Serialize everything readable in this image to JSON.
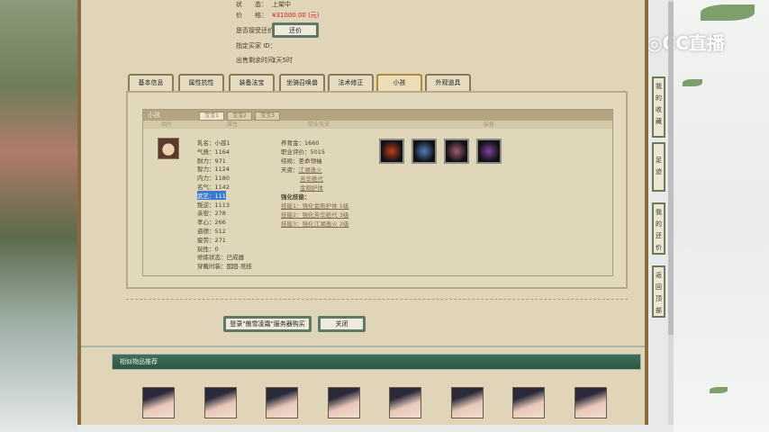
{
  "top_info": {
    "status_label": "状　　态：",
    "status_value": "上架中",
    "price_label": "价　　格：",
    "price_value": "¥31000.00 (元)",
    "counter_label": "是否接受还价：",
    "counter_button": "还价",
    "buyer_label": "指定买家 ID：",
    "time_label": "出售剩余时间：",
    "time_value": "1天5时"
  },
  "tabs": [
    "基本信息",
    "属性抗性",
    "装备法宝",
    "坐骑召唤兽",
    "法术修正",
    "小孩",
    "外观道具"
  ],
  "child": {
    "title": "小孩",
    "subtabs": [
      "宝宝1",
      "宝宝2",
      "宝宝3"
    ],
    "columns": [
      "图片",
      "属性",
      "职业天资",
      "装备"
    ],
    "attributes": [
      {
        "k": "乳名：",
        "v": "小孩1"
      },
      {
        "k": "气质：",
        "v": "1164"
      },
      {
        "k": "耐力：",
        "v": "971"
      },
      {
        "k": "智力：",
        "v": "1124"
      },
      {
        "k": "内力：",
        "v": "1180"
      },
      {
        "k": "名气：",
        "v": "1142"
      },
      {
        "k": "武艺：",
        "v": "111"
      },
      {
        "k": "叛逆：",
        "v": "1113"
      },
      {
        "k": "亲密：",
        "v": "278"
      },
      {
        "k": "孝心：",
        "v": "266"
      },
      {
        "k": "道德：",
        "v": "512"
      },
      {
        "k": "疲劳：",
        "v": "271"
      },
      {
        "k": "玩性：",
        "v": "0"
      },
      {
        "k": "修炼状态：",
        "v": "已成器"
      },
      {
        "k": "穿戴时装：",
        "v": "囡囡-竞技"
      }
    ],
    "career": {
      "money_k": "养育金：",
      "money_v": "1660",
      "eval_k": "职业评价：",
      "eval_v": "5015",
      "ending_k": "结局：",
      "ending_v": "圣命领袖",
      "talent_k": "天资：",
      "talents": [
        "江湖逸火",
        "芳华绝代",
        "金刚护体"
      ],
      "skill_k": "强化技能：",
      "skills": [
        "技能1：强化金刚护体 1级",
        "技能2：强化芳华绝代 3级",
        "技能3：强化江湖逸火 2级"
      ]
    }
  },
  "buttons": {
    "login_buy": "登录\"傲雪凌霜\"服务器购买",
    "close": "关闭"
  },
  "recommend": {
    "title": "相似物品推荐",
    "count": 8
  },
  "sidebar": [
    "我的收藏",
    "足迹",
    "我的还价",
    "返回顶部"
  ],
  "watermark": "CC直播"
}
